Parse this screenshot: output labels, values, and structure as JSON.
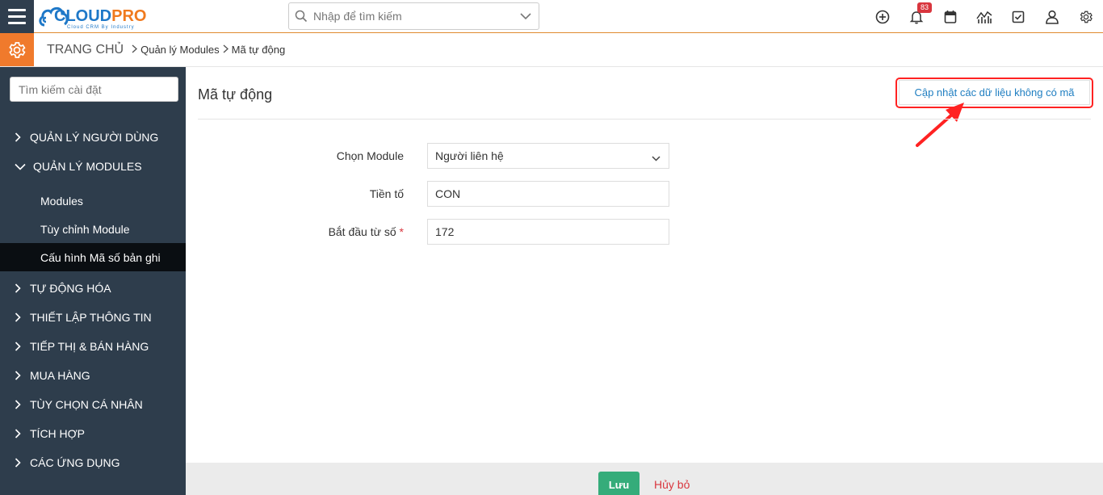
{
  "header": {
    "logo": {
      "brand_part1": "CLOUD",
      "brand_part2": "PRO",
      "tagline": "Cloud CRM By Industry"
    },
    "search_placeholder": "Nhập để tìm kiếm",
    "notification_count": "83",
    "icons": [
      "add-circle-icon",
      "bell-icon",
      "calendar-icon",
      "chart-icon",
      "checkbox-icon",
      "user-icon",
      "gear-icon"
    ]
  },
  "breadcrumb": {
    "home": "TRANG CHỦ",
    "level1": "Quản lý Modules",
    "level2": "Mã tự động"
  },
  "sidebar": {
    "search_placeholder": "Tìm kiếm cài đặt",
    "sections": [
      {
        "label": "QUẢN LÝ NGƯỜI DÙNG",
        "expanded": false
      },
      {
        "label": "QUẢN LÝ MODULES",
        "expanded": true
      },
      {
        "label": "TỰ ĐỘNG HÓA",
        "expanded": false
      },
      {
        "label": "THIẾT LẬP THÔNG TIN",
        "expanded": false
      },
      {
        "label": "TIẾP THỊ & BÁN HÀNG",
        "expanded": false
      },
      {
        "label": "MUA HÀNG",
        "expanded": false
      },
      {
        "label": "TÙY CHỌN CÁ NHÂN",
        "expanded": false
      },
      {
        "label": "TÍCH HỢP",
        "expanded": false
      },
      {
        "label": "CÁC ỨNG DỤNG",
        "expanded": false
      }
    ],
    "subitems": [
      {
        "label": "Modules",
        "active": false
      },
      {
        "label": "Tùy chỉnh Module",
        "active": false
      },
      {
        "label": "Cấu hình Mã số bản ghi",
        "active": true
      }
    ]
  },
  "main": {
    "title": "Mã tự động",
    "update_button": "Cập nhật các dữ liệu không có mã",
    "fields": {
      "module": {
        "label": "Chọn Module",
        "value": "Người liên hệ"
      },
      "prefix": {
        "label": "Tiền tố",
        "value": "CON"
      },
      "start": {
        "label": "Bắt đầu từ số",
        "required_mark": "*",
        "value": "172"
      }
    }
  },
  "footer": {
    "save": "Lưu",
    "cancel": "Hủy bỏ"
  },
  "colors": {
    "accent": "#f07a2c",
    "sidebar": "#2e3d4c",
    "link": "#1f7ec1",
    "save": "#35ac7a",
    "danger": "#d9363e",
    "highlight": "#ff2222"
  }
}
